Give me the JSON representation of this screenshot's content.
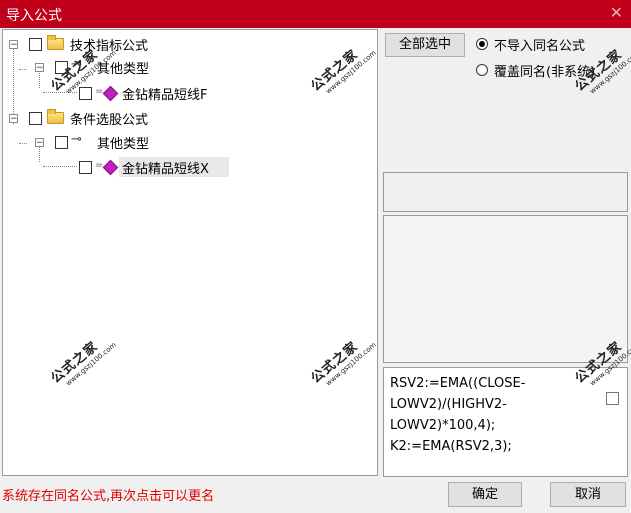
{
  "window": {
    "title": "导入公式",
    "close_glyph": "✕"
  },
  "tree": {
    "nodes": [
      {
        "label": "技术指标公式",
        "expander": "−"
      },
      {
        "label": "其他类型",
        "expander": "−"
      },
      {
        "label": "金钻精品短线F"
      },
      {
        "label": "条件选股公式",
        "expander": "−"
      },
      {
        "label": "其他类型",
        "expander": "−"
      },
      {
        "label": "金钻精品短线X"
      }
    ]
  },
  "select_all_button": "全部选中",
  "radio": {
    "no_import_same_name": "不导入同名公式",
    "overwrite_same_name": "覆盖同名(非系统)"
  },
  "formula_text": [
    "RSV2:=EMA((CLOSE-",
    "LOWV2)/(HIGHV2-",
    "LOWV2)*100,4);",
    "K2:=EMA(RSV2,3);"
  ],
  "status_message": "系统存在同名公式,再次点击可以更名",
  "buttons": {
    "ok": "确定",
    "cancel": "取消"
  },
  "watermark": {
    "text": "公式之家",
    "url": "www.gszj100.com"
  }
}
